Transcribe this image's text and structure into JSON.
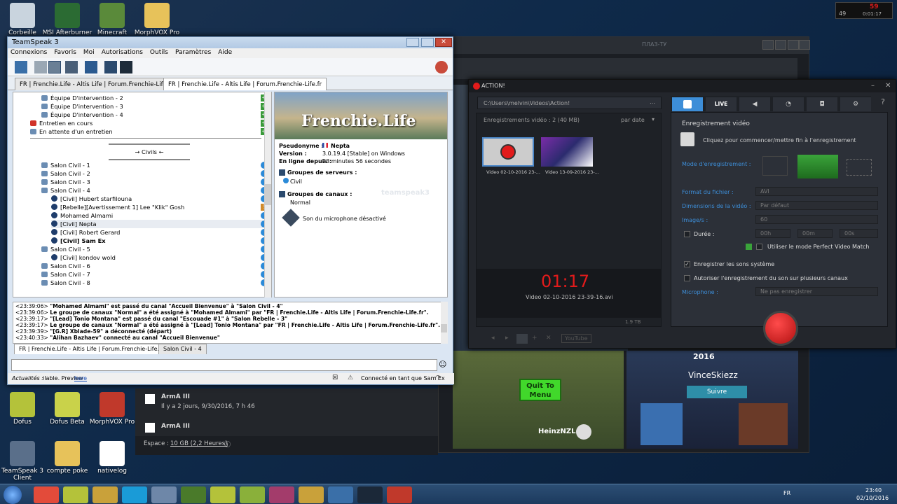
{
  "desktop": {
    "icons_top": [
      {
        "label": "Corbeille",
        "color": "#c9d4de"
      },
      {
        "label": "MSI Afterburner",
        "color": "#2b6b33"
      },
      {
        "label": "Minecraft",
        "color": "#5a8a3a"
      },
      {
        "label": "MorphVOX Pro",
        "color": "#e7c25a"
      }
    ],
    "icons_bottom": [
      {
        "label": "Dofus",
        "color": "#b4c23a"
      },
      {
        "label": "Dofus Beta",
        "color": "#c9d24a"
      },
      {
        "label": "MorphVOX Pro",
        "color": "#c0392b"
      },
      {
        "label": "TeamSpeak 3 Client",
        "color": "#5a6f8a"
      },
      {
        "label": "compte poke",
        "color": "#e7c25a"
      },
      {
        "label": "nativelog",
        "color": "#ffffff"
      }
    ]
  },
  "fps_overlay": {
    "line1": "59",
    "line2": "49",
    "line3": "0:01:17"
  },
  "steam": {
    "store_word": "ПЛАЗ-ТУ",
    "quit_label": "Quit To Menu",
    "player_name": "HeinzNZL",
    "year": "2016",
    "streamer": "VinceSkiezz",
    "follow": "Suivre",
    "activity": [
      {
        "game": "ArmA III",
        "when": "Il y a 2 jours, 9/30/2016, 7 h 46"
      },
      {
        "game": "ArmA III",
        "when": ""
      }
    ],
    "space_label": "Espace :",
    "space_value": "10 GB (2,2 Heures)"
  },
  "teamspeak": {
    "title": "TeamSpeak 3",
    "menu": [
      "Connexions",
      "Favoris",
      "Moi",
      "Autorisations",
      "Outils",
      "Paramètres",
      "Aide"
    ],
    "tabs": [
      "FR | Frenchie.Life - Altis Life | Forum.Frenchie-Life.fr",
      "FR | Frenchie.Life - Altis Life | Forum.Frenchie-Life.fr"
    ],
    "tree": [
      {
        "type": "channel",
        "indent": 1,
        "label": "Équipe D'intervention - 2",
        "badge": "plus"
      },
      {
        "type": "channel",
        "indent": 1,
        "label": "Équipe D'intervention - 3",
        "badge": "plus"
      },
      {
        "type": "channel",
        "indent": 1,
        "label": "Équipe D'intervention - 4",
        "badge": "plus"
      },
      {
        "type": "channel-red",
        "indent": 0,
        "label": "Entretien en cours",
        "badge": "plus"
      },
      {
        "type": "channel",
        "indent": 0,
        "label": "En attente d'un entretien",
        "badge": "plus"
      },
      {
        "type": "spacer",
        "indent": 0,
        "label": "",
        "badge": ""
      },
      {
        "type": "spacer",
        "indent": 0,
        "label": "",
        "badge": ""
      },
      {
        "type": "spacer",
        "indent": 0,
        "label": "",
        "badge": ""
      },
      {
        "type": "channel",
        "indent": 1,
        "label": "Salon Civil - 1",
        "badge": "blue"
      },
      {
        "type": "channel",
        "indent": 1,
        "label": "Salon Civil - 2",
        "badge": "blue"
      },
      {
        "type": "channel",
        "indent": 1,
        "label": "Salon Civil - 3",
        "badge": "blue"
      },
      {
        "type": "channel",
        "indent": 1,
        "label": "Salon Civil - 4",
        "badge": "blue"
      },
      {
        "type": "user",
        "indent": 2,
        "label": "[Civil] Hubert starfilouna",
        "badge": "blue"
      },
      {
        "type": "user",
        "indent": 2,
        "label": "[Rebelle][Avertissement 1] Lee \"Klik\" Gosh",
        "badge": "warn"
      },
      {
        "type": "user",
        "indent": 2,
        "label": "Mohamed Almami",
        "badge": "blue"
      },
      {
        "type": "user-sel",
        "indent": 2,
        "label": "[Civil] Nepta",
        "badge": "blue"
      },
      {
        "type": "user",
        "indent": 2,
        "label": "[Civil] Robert Gerard",
        "badge": "blue"
      },
      {
        "type": "user-bold",
        "indent": 2,
        "label": "[Civil] Sam Ex",
        "badge": "blue"
      },
      {
        "type": "channel",
        "indent": 1,
        "label": "Salon Civil - 5",
        "badge": "blue"
      },
      {
        "type": "user",
        "indent": 2,
        "label": "[Civil] kondov wold",
        "badge": "blue"
      },
      {
        "type": "channel",
        "indent": 1,
        "label": "Salon Civil - 6",
        "badge": "blue"
      },
      {
        "type": "channel",
        "indent": 1,
        "label": "Salon Civil - 7",
        "badge": "blue"
      },
      {
        "type": "channel",
        "indent": 1,
        "label": "Salon Civil - 8",
        "badge": "blue"
      }
    ],
    "spacer_label": "→ Civils ←",
    "info": {
      "banner": "Frenchie.Life",
      "fields": [
        {
          "label": "Pseudonyme :",
          "value": "Nepta"
        },
        {
          "label": "Version :",
          "value": "3.0.19.4 [Stable] on Windows"
        },
        {
          "label": "En ligne depuis :",
          "value": "23 minutes 56 secondes"
        }
      ],
      "server_groups_label": "Groupes de serveurs :",
      "server_group": "Civil",
      "channel_groups_label": "Groupes de canaux :",
      "channel_group": "Normal",
      "mic_status": "Son du microphone désactivé",
      "watermark": "teamspeak3"
    },
    "log": [
      {
        "time": "<23:39:06>",
        "text": "\"Mohamed Almami\" est passé du canal \"Accueil Bienvenue\" à \"Salon Civil - 4\""
      },
      {
        "time": "<23:39:06>",
        "text": "Le groupe de canaux \"Normal\" a été assigné à \"Mohamed Almami\" par \"FR | Frenchie.Life - Altis Life | Forum.Frenchie-Life.fr\"."
      },
      {
        "time": "<23:39:17>",
        "text": "\"[Lead] Tonio Montana\" est passé du canal \"Escouade #1\" à \"Salon Rebelle - 3\""
      },
      {
        "time": "<23:39:17>",
        "text": "Le groupe de canaux \"Normal\" a été assigné à \"[Lead] Tonio Montana\" par \"FR | Frenchie.Life - Altis Life | Forum.Frenchie-Life.fr\"."
      },
      {
        "time": "<23:39:39>",
        "text": "\"[G.R] Xblade-59\" a déconnecté (départ)"
      },
      {
        "time": "<23:40:33>",
        "text": "\"Alihan Bazhaev\" connecté au canal \"Accueil Bienvenue\""
      }
    ],
    "bottom_tabs": [
      "FR | Frenchie.Life - Altis Life | Forum.Frenchie-Life.fr",
      "Salon Civil - 4"
    ],
    "status_news_label": "Actualités :",
    "status_news": "ilable. Preview ",
    "status_news_link": "here",
    "status_connected": "Connecté en tant que Sam Ex"
  },
  "action": {
    "title": "ACTION!",
    "path": "C:\\Users\\melvin\\Videos\\Action!",
    "recordings_label": "Enregistrements vidéo : 2 (40 MB)",
    "sort_label": "par date",
    "thumbs": [
      {
        "caption": "Video 02-10-2016 23-...",
        "num": "1"
      },
      {
        "caption": "Video 13-09-2016 23-...",
        "num": ""
      }
    ],
    "timer": "01:17",
    "current_file": "Video 02-10-2016 23-39-16.avi",
    "disk": "1.9 TB",
    "tabs": [
      "rec",
      "LIVE",
      "audio",
      "bench",
      "screenshot",
      "settings"
    ],
    "section_title": "Enregistrement vidéo",
    "hint": "Cliquez pour commencer/mettre fin à l'enregistrement",
    "mode_label": "Mode d'enregistrement :",
    "format_label": "Format du fichier :",
    "format_value": "AVI",
    "dim_label": "Dimensions de la vidéo :",
    "dim_value": "Par défaut",
    "fps_label": "Image/s :",
    "fps_value": "60",
    "duration_label": "Durée :",
    "duration": [
      "00h",
      "00m",
      "00s"
    ],
    "perfect_match": "Utiliser le mode Perfect Video Match",
    "sys_sounds": "Enregistrer les sons système",
    "multi_channel": "Autoriser l'enregistrement du son sur plusieurs canaux",
    "mic_label": "Microphone :",
    "mic_value": "Ne pas enregistrer",
    "youtube": "YouTube"
  },
  "taskbar": {
    "apps": [
      {
        "name": "chrome",
        "color": "#e34b3a"
      },
      {
        "name": "dofus",
        "color": "#b4c23a"
      },
      {
        "name": "league",
        "color": "#c9a13a"
      },
      {
        "name": "skype",
        "color": "#1a9bd7"
      },
      {
        "name": "teamspeak",
        "color": "#6e87a8"
      },
      {
        "name": "minecraft",
        "color": "#4a7a2a"
      },
      {
        "name": "dofus-beta",
        "color": "#b4c23a"
      },
      {
        "name": "dofus-2",
        "color": "#8ab03a"
      },
      {
        "name": "winrar",
        "color": "#a33c6b"
      },
      {
        "name": "league-2",
        "color": "#c9a13a"
      },
      {
        "name": "player",
        "color": "#3a6fa8"
      },
      {
        "name": "steam",
        "color": "#1b2838"
      },
      {
        "name": "action",
        "color": "#c0392b"
      }
    ],
    "lang": "FR",
    "time": "23:40",
    "date": "02/10/2016"
  },
  "colors": {
    "ts_blue": "#2b8ad8",
    "action_accent": "#3d8ed8",
    "action_red": "#e21b1b",
    "quit_green": "#41d82b"
  }
}
